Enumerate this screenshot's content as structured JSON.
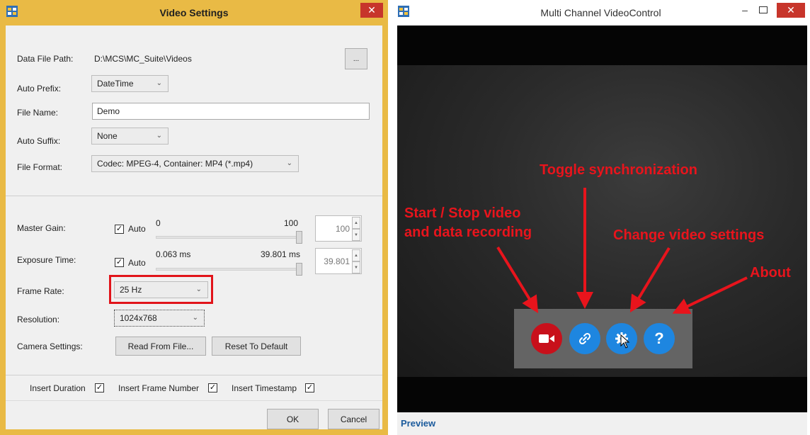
{
  "dialog": {
    "title": "Video Settings",
    "close_glyph": "✕",
    "fields": {
      "data_file_path": {
        "label": "Data File Path:",
        "value": "D:\\MCS\\MC_Suite\\Videos",
        "browse_label": "..."
      },
      "auto_prefix": {
        "label": "Auto Prefix:",
        "value": "DateTime"
      },
      "file_name": {
        "label": "File Name:",
        "value": "Demo"
      },
      "auto_suffix": {
        "label": "Auto Suffix:",
        "value": "None"
      },
      "file_format": {
        "label": "File Format:",
        "value": "Codec: MPEG-4, Container: MP4 (*.mp4)"
      },
      "master_gain": {
        "label": "Master Gain:",
        "auto_label": "Auto",
        "auto_checked": true,
        "min": "0",
        "max": "100",
        "value": "100",
        "level": 1.0
      },
      "exposure_time": {
        "label": "Exposure Time:",
        "auto_label": "Auto",
        "auto_checked": true,
        "min": "0.063 ms",
        "max": "39.801 ms",
        "value": "39.801",
        "level": 1.0
      },
      "frame_rate": {
        "label": "Frame Rate:",
        "value": "25 Hz"
      },
      "resolution": {
        "label": "Resolution:",
        "value": "1024x768"
      },
      "camera_settings": {
        "label": "Camera Settings:",
        "read_button": "Read From File...",
        "reset_button": "Reset To Default"
      }
    },
    "options": {
      "insert_duration": {
        "label": "Insert Duration",
        "checked": true
      },
      "insert_frame_number": {
        "label": "Insert Frame Number",
        "checked": true
      },
      "insert_timestamp": {
        "label": "Insert Timestamp",
        "checked": true
      }
    },
    "footer": {
      "ok": "OK",
      "cancel": "Cancel"
    },
    "highlight_color": "#e1141a"
  },
  "window": {
    "title": "Multi Channel VideoControl",
    "min_glyph": "–",
    "close_glyph": "✕",
    "preview_label": "Preview",
    "callouts": {
      "record": [
        "Start / Stop video",
        "and data recording"
      ],
      "sync": "Toggle synchronization",
      "settings": "Change video settings",
      "about": "About"
    },
    "controls": [
      {
        "name": "record",
        "icon": "video-camera-icon",
        "color": "#c8101b"
      },
      {
        "name": "sync",
        "icon": "link-icon",
        "color": "#1e86e0"
      },
      {
        "name": "settings",
        "icon": "gear-icon",
        "color": "#1e86e0"
      },
      {
        "name": "about",
        "icon": "question-icon",
        "glyph": "?",
        "color": "#1e86e0"
      }
    ],
    "callout_color": "#e8141c"
  }
}
